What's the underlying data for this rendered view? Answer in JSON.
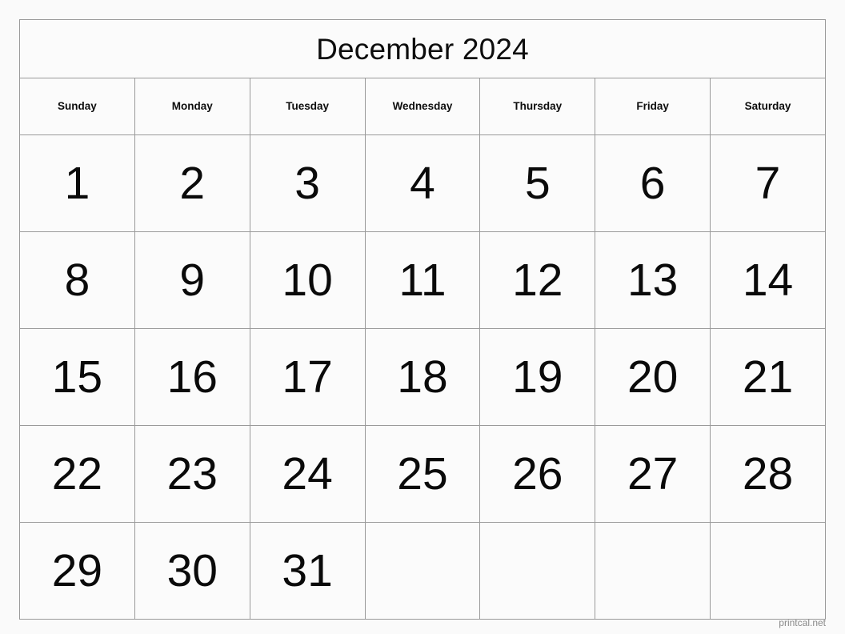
{
  "calendar": {
    "title": "December 2024",
    "month": "December",
    "year": "2024",
    "weekdays": [
      "Sunday",
      "Monday",
      "Tuesday",
      "Wednesday",
      "Thursday",
      "Friday",
      "Saturday"
    ],
    "weeks": [
      [
        "1",
        "2",
        "3",
        "4",
        "5",
        "6",
        "7"
      ],
      [
        "8",
        "9",
        "10",
        "11",
        "12",
        "13",
        "14"
      ],
      [
        "15",
        "16",
        "17",
        "18",
        "19",
        "20",
        "21"
      ],
      [
        "22",
        "23",
        "24",
        "25",
        "26",
        "27",
        "28"
      ],
      [
        "29",
        "30",
        "31",
        "",
        "",
        "",
        ""
      ]
    ],
    "colors": {
      "page_background": "#fafafa",
      "cell_background": "#fbfbfb",
      "border": "#9a9a9a",
      "text": "#0d0d0d",
      "footer_text": "#8a8a8a"
    }
  },
  "footer": {
    "attribution": "printcal.net"
  }
}
